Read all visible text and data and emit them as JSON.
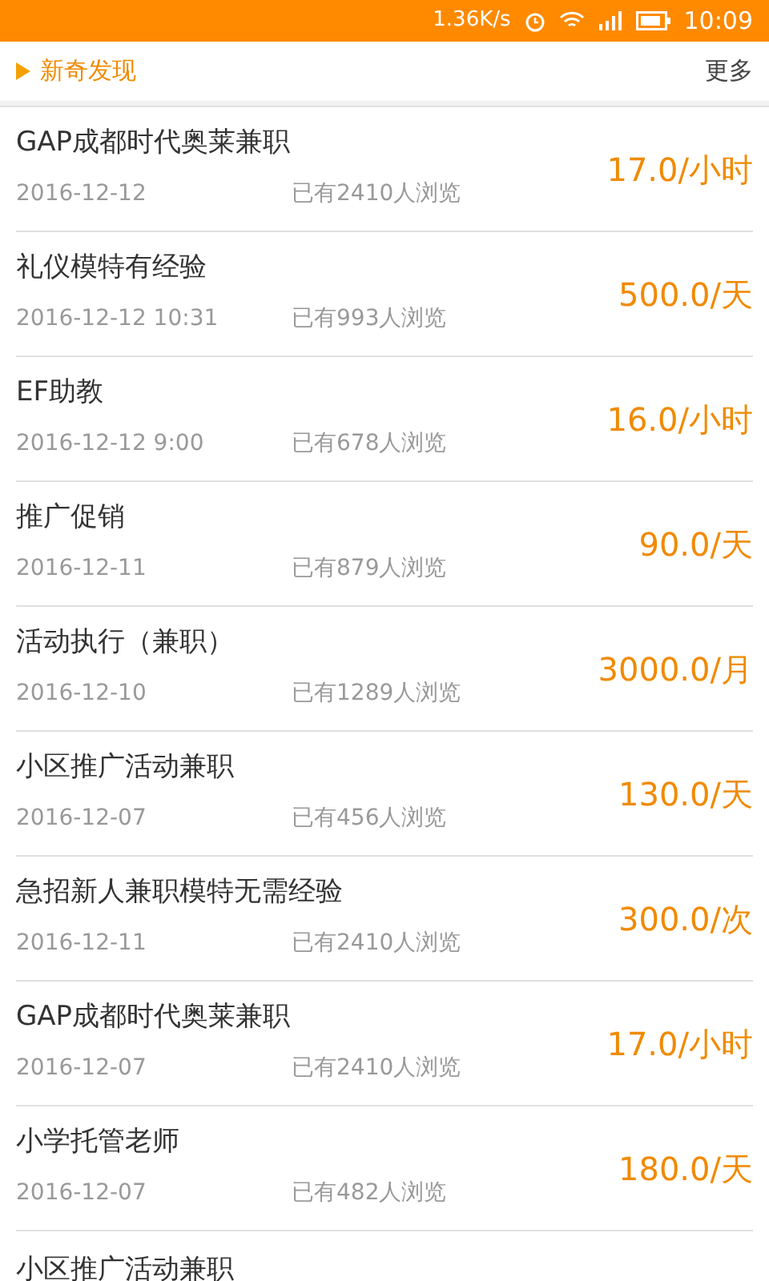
{
  "status_bar": {
    "speed": "1.36K/s",
    "time": "10:09"
  },
  "section": {
    "title": "新奇发现",
    "more": "更多"
  },
  "jobs": [
    {
      "title": "GAP成都时代奥莱兼职",
      "date": "2016-12-12",
      "views": "已有2410人浏览",
      "pay": "17.0/小时"
    },
    {
      "title": "礼仪模特有经验",
      "date": "2016-12-12 10:31",
      "views": "已有993人浏览",
      "pay": "500.0/天"
    },
    {
      "title": "EF助教",
      "date": "2016-12-12 9:00",
      "views": "已有678人浏览",
      "pay": "16.0/小时"
    },
    {
      "title": "推广促销",
      "date": "2016-12-11",
      "views": "已有879人浏览",
      "pay": "90.0/天"
    },
    {
      "title": "活动执行（兼职）",
      "date": "2016-12-10",
      "views": "已有1289人浏览",
      "pay": "3000.0/月"
    },
    {
      "title": "小区推广活动兼职",
      "date": "2016-12-07",
      "views": "已有456人浏览",
      "pay": "130.0/天"
    },
    {
      "title": "急招新人兼职模特无需经验",
      "date": "2016-12-11",
      "views": "已有2410人浏览",
      "pay": "300.0/次"
    },
    {
      "title": "GAP成都时代奥莱兼职",
      "date": "2016-12-07",
      "views": "已有2410人浏览",
      "pay": "17.0/小时"
    },
    {
      "title": "小学托管老师",
      "date": "2016-12-07",
      "views": "已有482人浏览",
      "pay": "180.0/天"
    },
    {
      "title": "小区推广活动兼职"
    }
  ]
}
